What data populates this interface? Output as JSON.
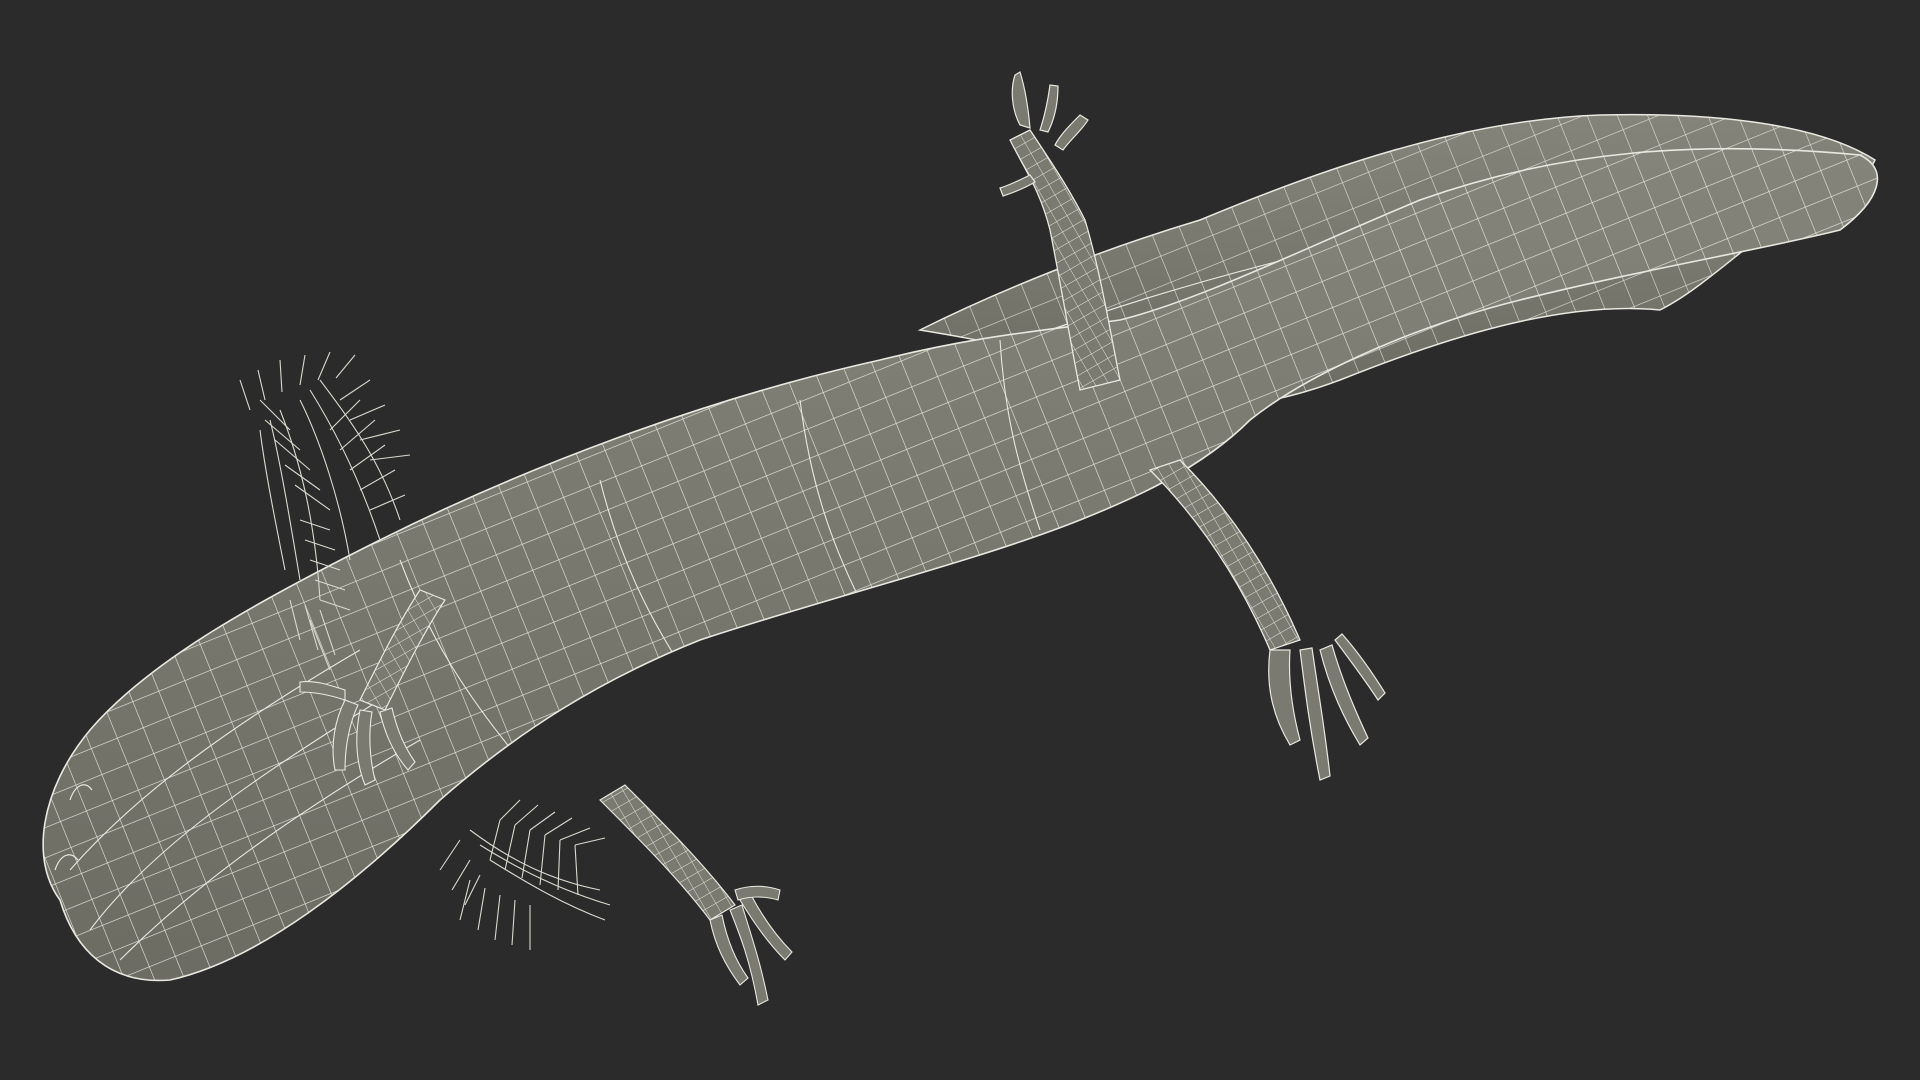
{
  "viewport": {
    "background_color": "#2b2b2b",
    "mesh_fill_color": "#7a7a70",
    "mesh_shade_color": "#6e6e65",
    "wire_color": "#e8e8e0",
    "gill_color": "#d9d9cf"
  },
  "model": {
    "subject": "axolotl",
    "render_style": "wireframe over grey shaded mesh"
  }
}
